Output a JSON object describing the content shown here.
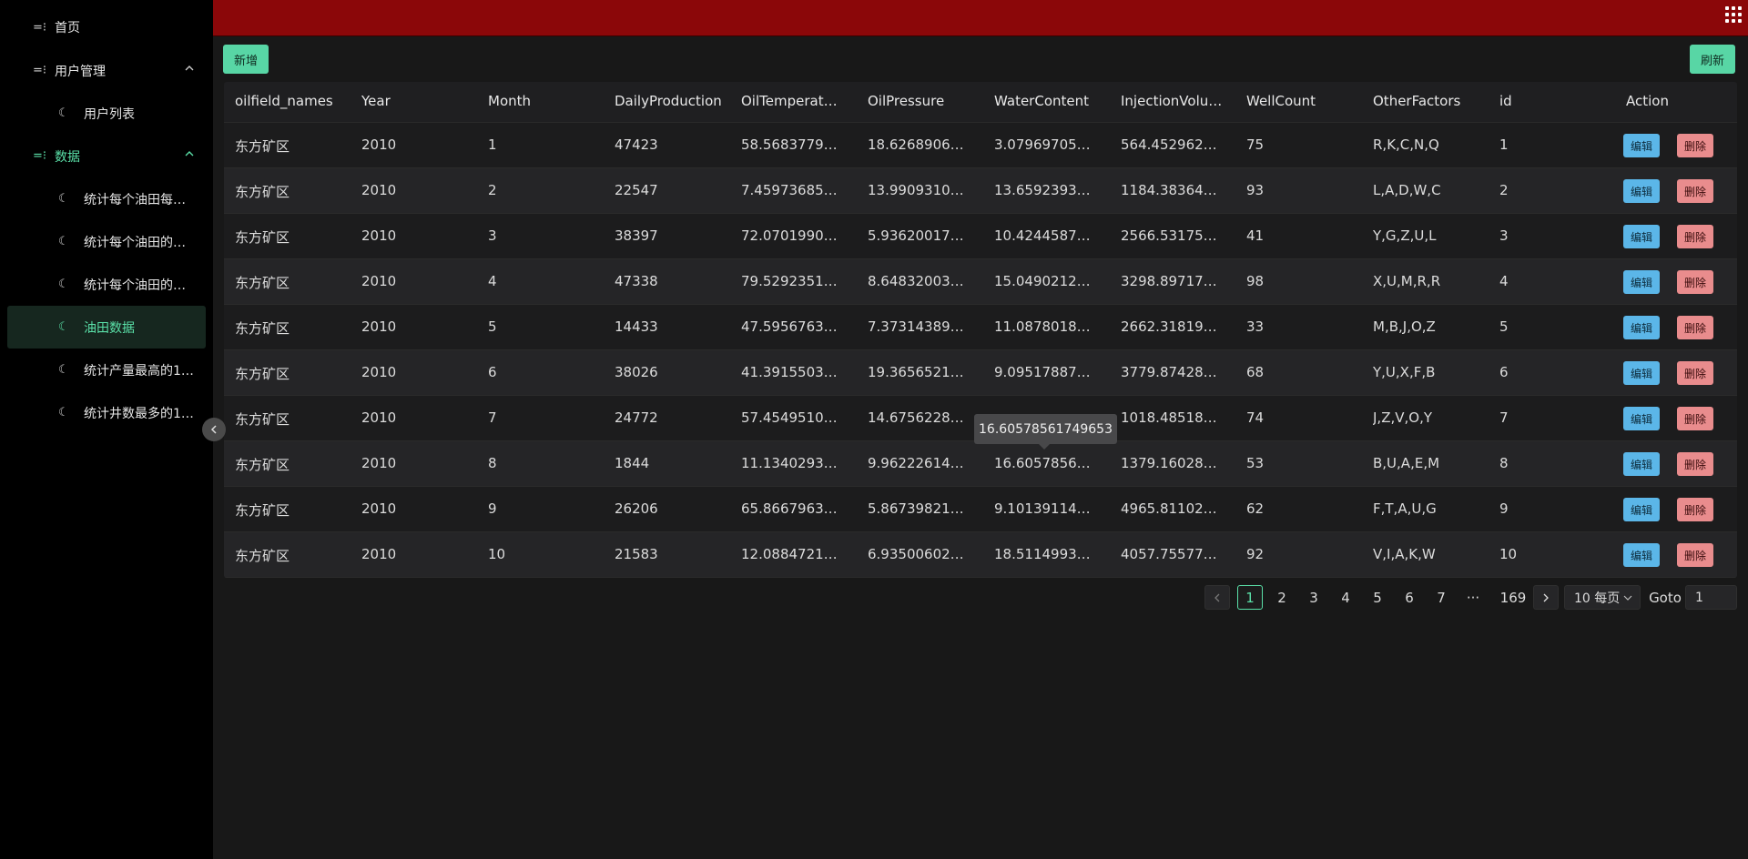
{
  "sidebar": {
    "home": "首页",
    "user_mgmt": "用户管理",
    "user_list": "用户列表",
    "data": "数据",
    "data_items": [
      "统计每个油田每月...",
      "统计每个油田的平...",
      "统计每个油田的平...",
      "油田数据",
      "统计产量最高的10...",
      "统计井数最多的10..."
    ]
  },
  "toolbar": {
    "add_label": "新增",
    "refresh_label": "刷新"
  },
  "table": {
    "columns": [
      "oilfield_names",
      "Year",
      "Month",
      "DailyProduction",
      "OilTemperature",
      "OilPressure",
      "WaterContent",
      "InjectionVolume",
      "WellCount",
      "OtherFactors",
      "id",
      "Action"
    ],
    "rows": [
      [
        "东方矿区",
        "2010",
        "1",
        "47423",
        "58.5683779396...",
        "18.6268906014...",
        "3.07969705578...",
        "564.452962780...",
        "75",
        "R,K,C,N,Q",
        "1"
      ],
      [
        "东方矿区",
        "2010",
        "2",
        "22547",
        "7.45973685334...",
        "13.9909310920...",
        "13.6592393321...",
        "1184.38364986...",
        "93",
        "L,A,D,W,C",
        "2"
      ],
      [
        "东方矿区",
        "2010",
        "3",
        "38397",
        "72.0701990941...",
        "5.93620017963...",
        "10.4244587125...",
        "2566.53175982...",
        "41",
        "Y,G,Z,U,L",
        "3"
      ],
      [
        "东方矿区",
        "2010",
        "4",
        "47338",
        "79.5292351204...",
        "8.64832003635...",
        "15.0490212765...",
        "3298.89717335...",
        "98",
        "X,U,M,R,R",
        "4"
      ],
      [
        "东方矿区",
        "2010",
        "5",
        "14433",
        "47.5956763389...",
        "7.37314389667...",
        "11.0878018260...",
        "2662.31819681...",
        "33",
        "M,B,J,O,Z",
        "5"
      ],
      [
        "东方矿区",
        "2010",
        "6",
        "38026",
        "41.3915503047...",
        "19.3656521578...",
        "9.09517887443...",
        "3779.87428093...",
        "68",
        "Y,U,X,F,B",
        "6"
      ],
      [
        "东方矿区",
        "2010",
        "7",
        "24772",
        "57.4549510058...",
        "14.6756228792...",
        "",
        "1018.48518005...",
        "74",
        "J,Z,V,O,Y",
        "7"
      ],
      [
        "东方矿区",
        "2010",
        "8",
        "1844",
        "11.1340293480...",
        "9.96222614078...",
        "16.6057856174...",
        "1379.16028228...",
        "53",
        "B,U,A,E,M",
        "8"
      ],
      [
        "东方矿区",
        "2010",
        "9",
        "26206",
        "65.8667963902...",
        "5.86739821435...",
        "9.10139114754...",
        "4965.81102500...",
        "62",
        "F,T,A,U,G",
        "9"
      ],
      [
        "东方矿区",
        "2010",
        "10",
        "21583",
        "12.0884721897...",
        "6.93500602875...",
        "18.5114993445...",
        "4057.75577591...",
        "92",
        "V,I,A,K,W",
        "10"
      ]
    ],
    "edit_label": "编辑",
    "delete_label": "删除"
  },
  "tooltip": "16.60578561749653",
  "pagination": {
    "pages": [
      "1",
      "2",
      "3",
      "4",
      "5",
      "6",
      "7",
      "···",
      "169"
    ],
    "current": "1",
    "page_size": "10 每页",
    "goto_label": "Goto",
    "goto_value": "1"
  },
  "colors": {
    "header": "#8b0709",
    "accent": "#5ae0a8",
    "edit": "#5bb6e8",
    "delete": "#e98c8d"
  }
}
